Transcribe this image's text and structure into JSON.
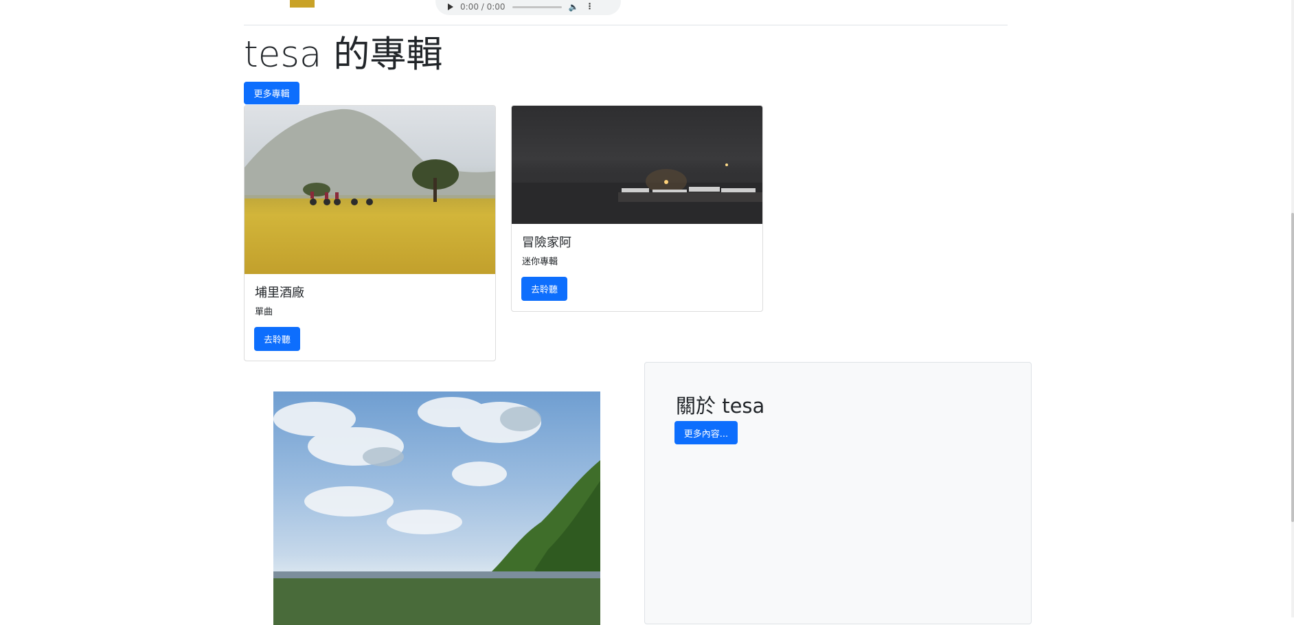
{
  "player": {
    "time": "0:00 / 0:00"
  },
  "section": {
    "title": "tesa 的專輯",
    "more_albums_label": "更多專輯"
  },
  "albums": [
    {
      "title": "埔里酒廠",
      "type": "單曲",
      "listen_label": "去聆聽"
    },
    {
      "title": "冒險家阿",
      "type": "迷你專輯",
      "listen_label": "去聆聽"
    }
  ],
  "about": {
    "title": "關於 tesa",
    "more_label": "更多內容..."
  },
  "colors": {
    "primary": "#0d6efd",
    "panel": "#f8f9fa"
  }
}
